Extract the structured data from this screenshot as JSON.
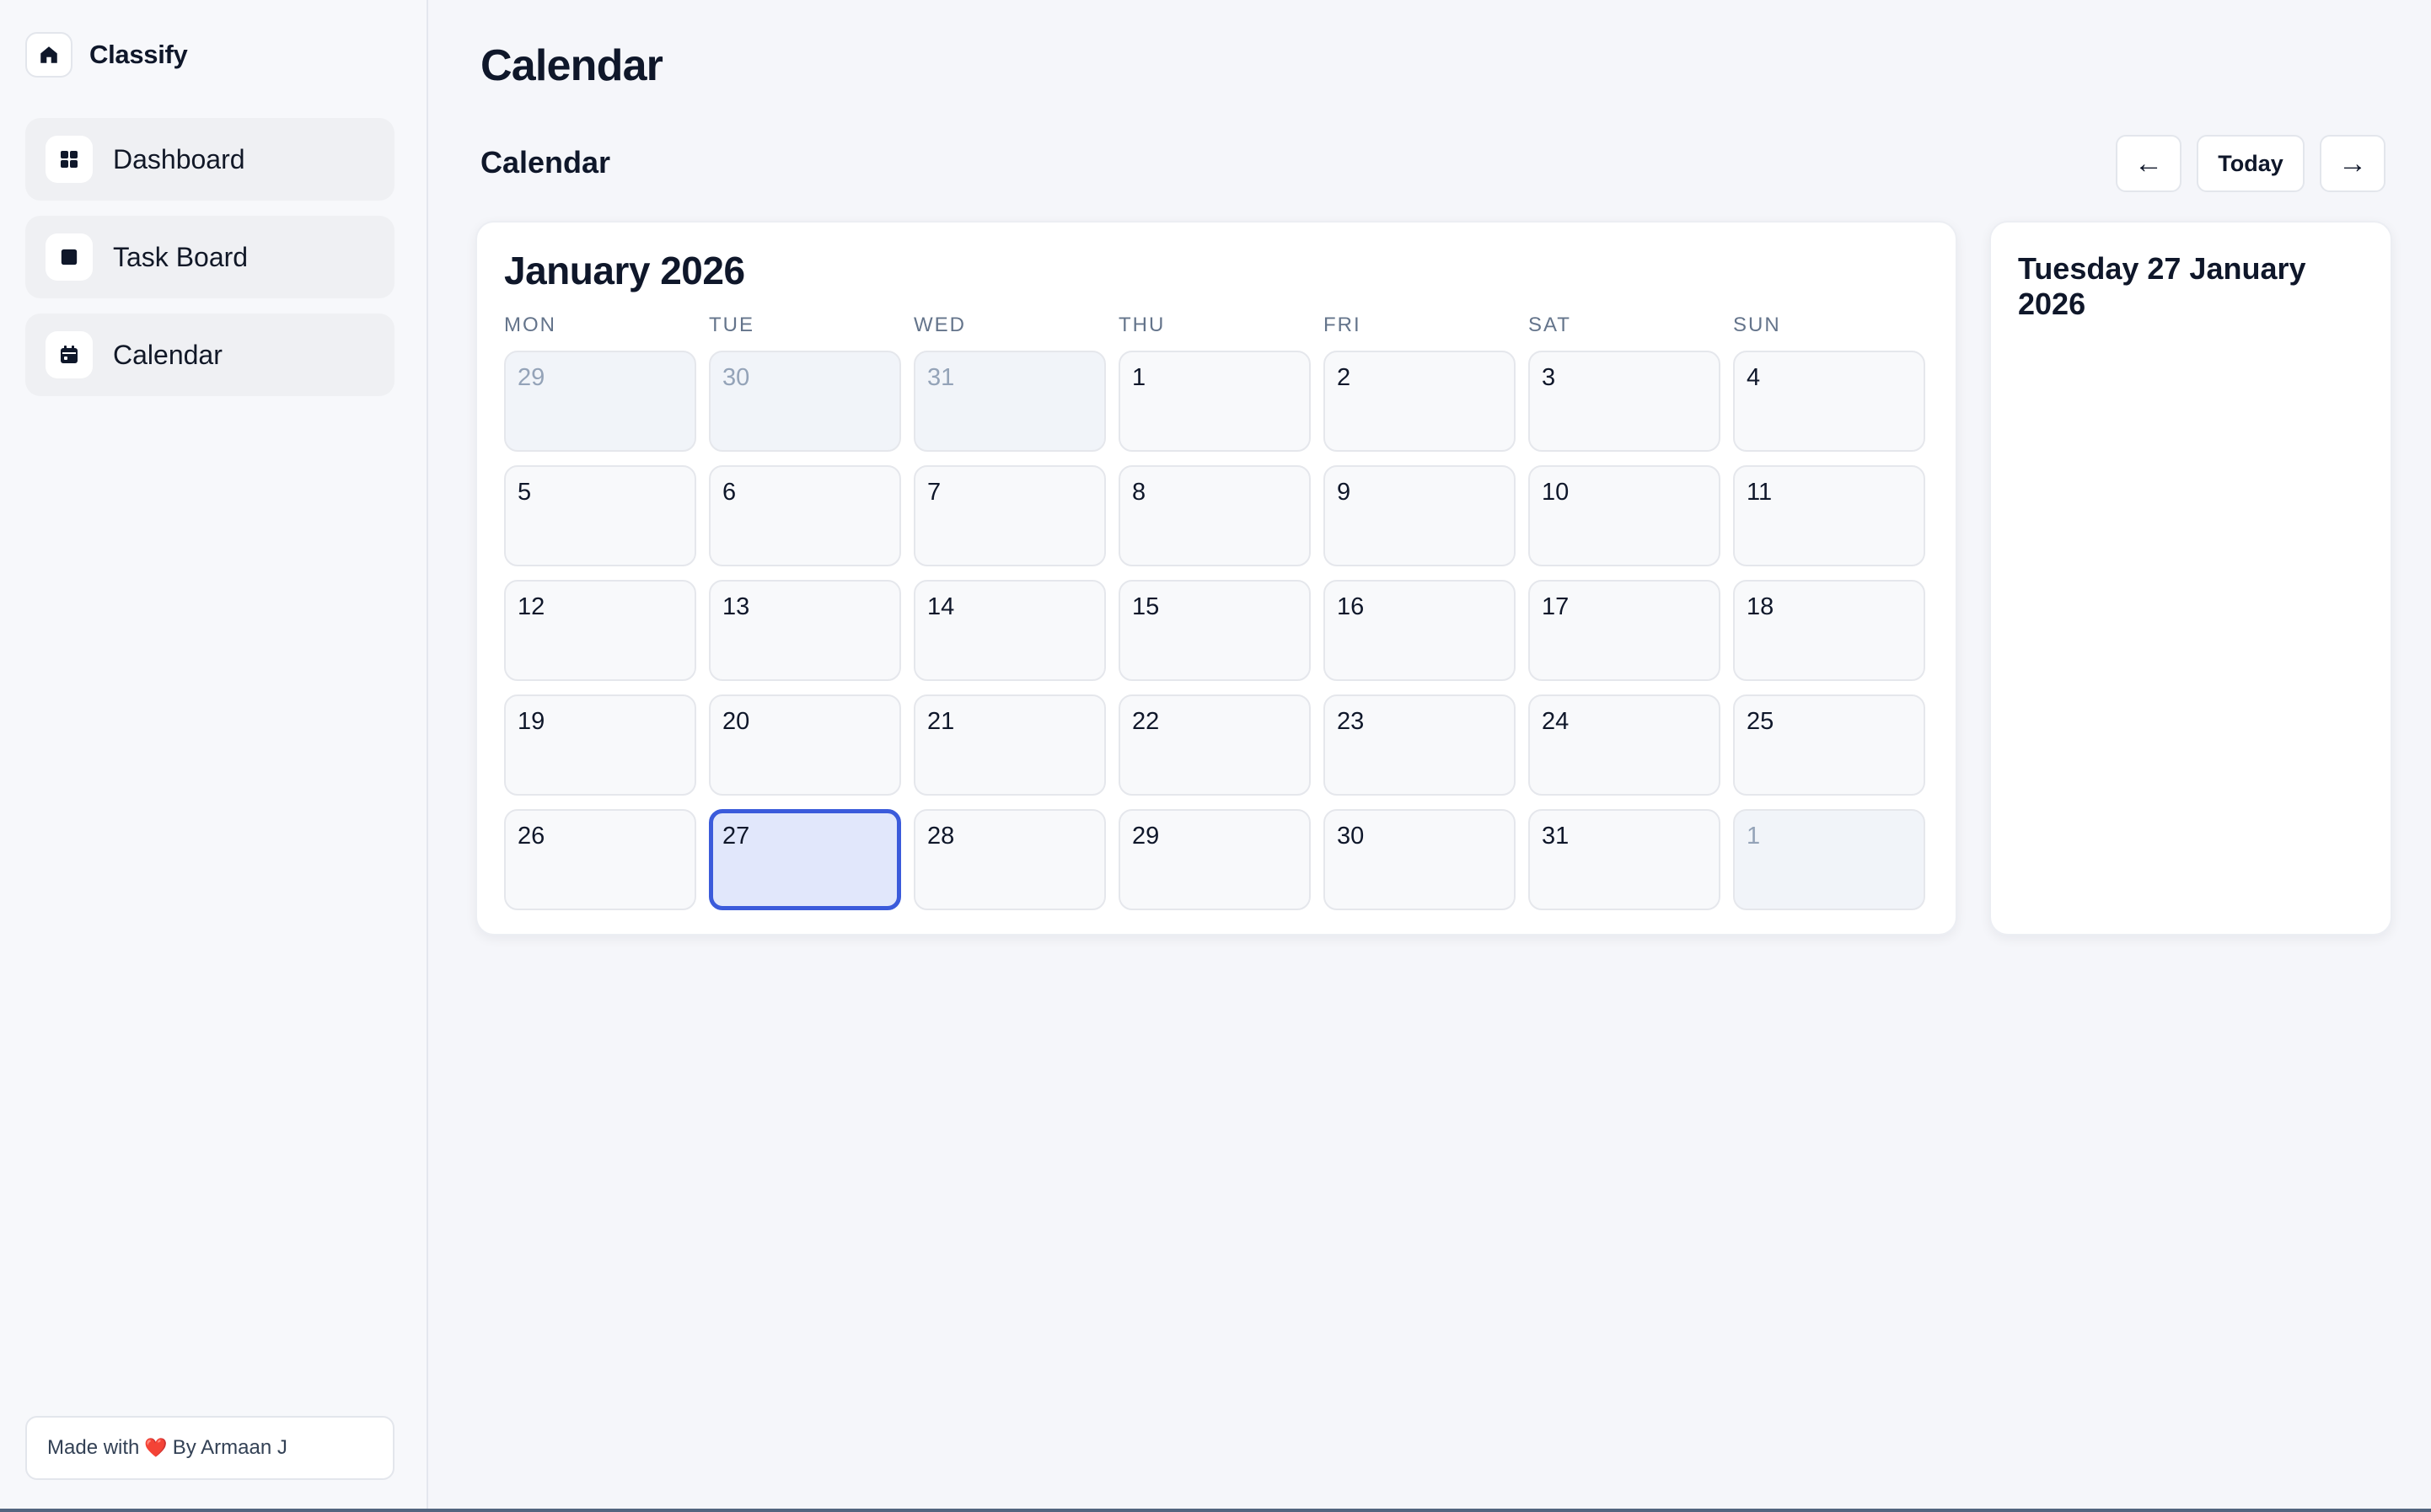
{
  "app": {
    "name": "Classify",
    "brand_icon": "home-icon"
  },
  "sidebar": {
    "items": [
      {
        "label": "Dashboard",
        "icon": "grid-icon"
      },
      {
        "label": "Task Board",
        "icon": "square-icon"
      },
      {
        "label": "Calendar",
        "icon": "calendar-icon"
      }
    ],
    "footer": {
      "prefix": "Made with",
      "heart": "❤️",
      "suffix": "By Armaan J"
    }
  },
  "main": {
    "page_title": "Calendar",
    "section_title": "Calendar",
    "controls": {
      "prev": "←",
      "today": "Today",
      "next": "→"
    }
  },
  "calendar": {
    "month_label": "January 2026",
    "weekdays": [
      "MON",
      "TUE",
      "WED",
      "THU",
      "FRI",
      "SAT",
      "SUN"
    ],
    "weeks": [
      [
        {
          "day": "29",
          "muted": true
        },
        {
          "day": "30",
          "muted": true
        },
        {
          "day": "31",
          "muted": true
        },
        {
          "day": "1"
        },
        {
          "day": "2"
        },
        {
          "day": "3"
        },
        {
          "day": "4"
        }
      ],
      [
        {
          "day": "5"
        },
        {
          "day": "6"
        },
        {
          "day": "7"
        },
        {
          "day": "8"
        },
        {
          "day": "9"
        },
        {
          "day": "10"
        },
        {
          "day": "11"
        }
      ],
      [
        {
          "day": "12"
        },
        {
          "day": "13"
        },
        {
          "day": "14"
        },
        {
          "day": "15"
        },
        {
          "day": "16"
        },
        {
          "day": "17"
        },
        {
          "day": "18"
        }
      ],
      [
        {
          "day": "19"
        },
        {
          "day": "20"
        },
        {
          "day": "21"
        },
        {
          "day": "22"
        },
        {
          "day": "23"
        },
        {
          "day": "24"
        },
        {
          "day": "25"
        }
      ],
      [
        {
          "day": "26"
        },
        {
          "day": "27",
          "selected": true
        },
        {
          "day": "28"
        },
        {
          "day": "29"
        },
        {
          "day": "30"
        },
        {
          "day": "31"
        },
        {
          "day": "1",
          "muted": true
        }
      ]
    ],
    "selected_date_label": "Tuesday 27 January 2026"
  },
  "colors": {
    "accent": "#3b5bdb",
    "selected_bg": "#e1e7fb",
    "muted_text": "#94a3b8",
    "text": "#0f172a"
  }
}
